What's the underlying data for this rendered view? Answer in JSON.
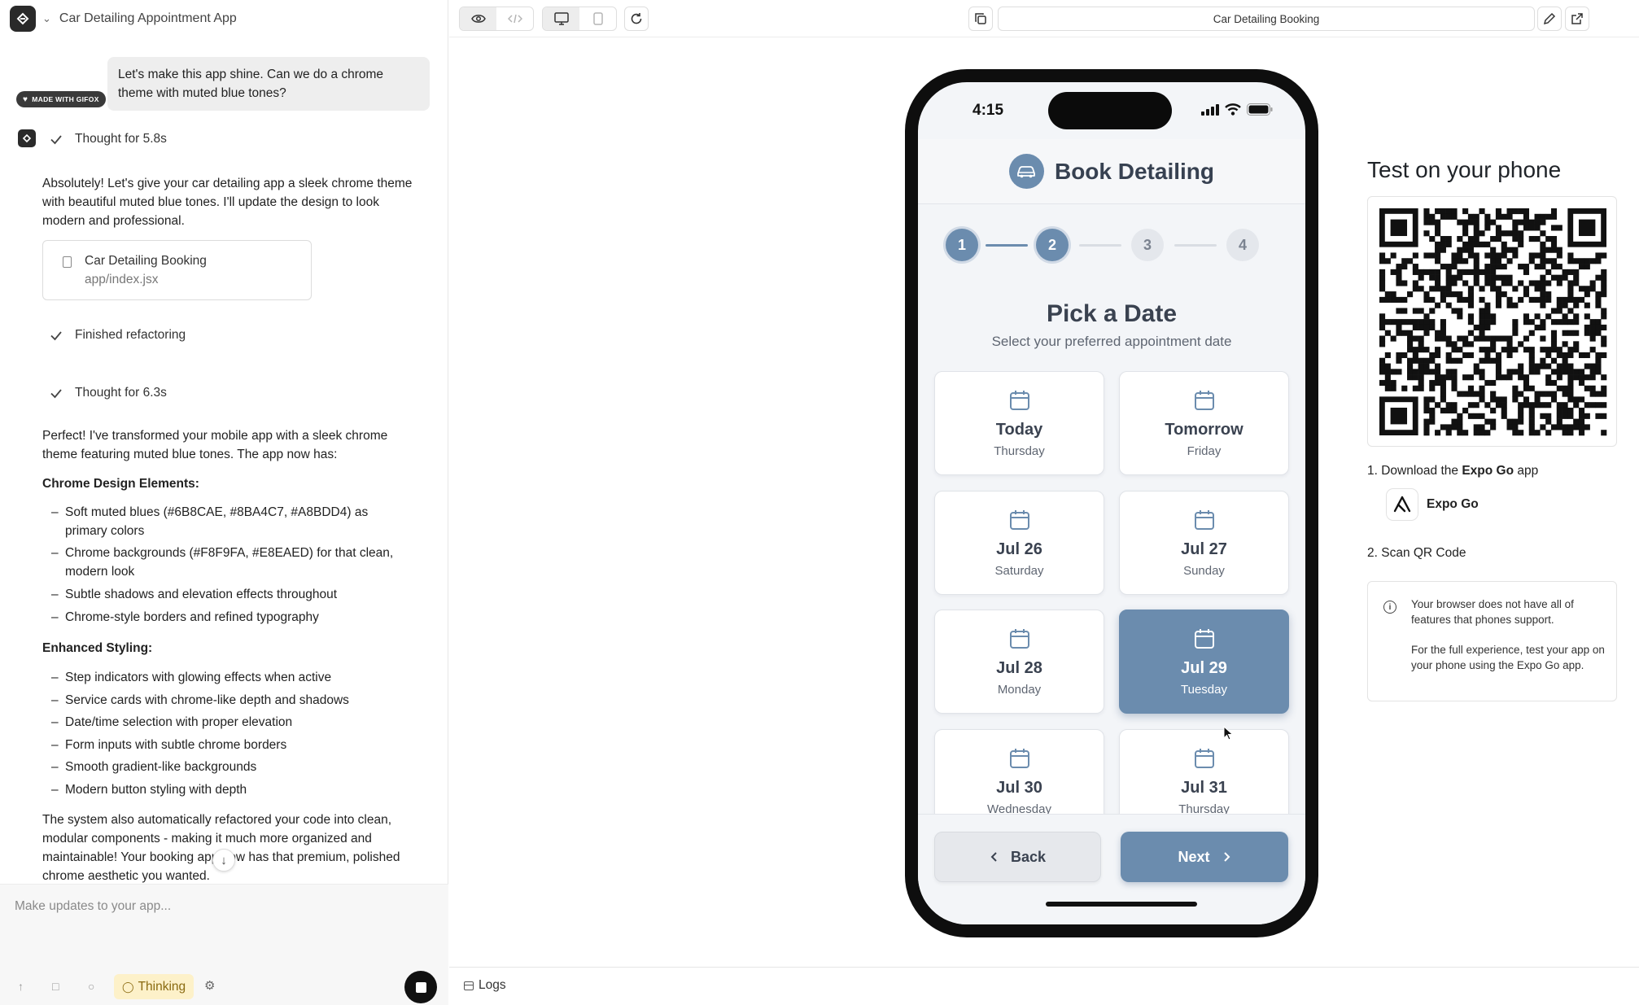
{
  "left": {
    "app_title": "Car Detailing Appointment App",
    "user_message": "Let's make this app shine. Can we do a chrome theme with muted blue tones?",
    "thought_1": "Thought for 5.8s",
    "response_1": "Absolutely! Let's give your car detailing app a sleek chrome theme with beautiful muted blue tones. I'll update the design to look modern and professional.",
    "file_card": {
      "name": "Car Detailing Booking",
      "path": "app/index.jsx"
    },
    "finished": "Finished refactoring",
    "thought_2": "Thought for 6.3s",
    "response_2": "Perfect! I've transformed your mobile app with a sleek chrome theme featuring muted blue tones. The app now has:",
    "section_1_title": "Chrome Design Elements:",
    "section_1_items": [
      "Soft muted blues (#6B8CAE, #8BA4C7, #A8BDD4) as primary colors",
      "Chrome backgrounds (#F8F9FA, #E8EAED) for that clean, modern look",
      "Subtle shadows and elevation effects throughout",
      "Chrome-style borders and refined typography"
    ],
    "section_2_title": "Enhanced Styling:",
    "section_2_items": [
      "Step indicators with glowing effects when active",
      "Service cards with chrome-like depth and shadows",
      "Date/time selection with proper elevation",
      "Form inputs with subtle chrome borders",
      "Smooth gradient-like backgrounds",
      "Modern button styling with depth"
    ],
    "closing": "The system also automatically refactored your code into clean, modular components - making it much more organized and maintainable! Your booking app now has that premium, polished chrome aesthetic you wanted.",
    "composer_placeholder": "Make updates to your app...",
    "gifox_badge": "MADE WITH GIFOX",
    "thinking_label": "Thinking"
  },
  "toolbar": {
    "url_title": "Car Detailing Booking"
  },
  "phone": {
    "time": "4:15",
    "header_title": "Book Detailing",
    "steps": [
      "1",
      "2",
      "3",
      "4"
    ],
    "current_step": 2,
    "heading": "Pick a Date",
    "subheading": "Select your preferred appointment date",
    "dates": [
      {
        "label": "Today",
        "day": "Thursday",
        "selected": false
      },
      {
        "label": "Tomorrow",
        "day": "Friday",
        "selected": false
      },
      {
        "label": "Jul 26",
        "day": "Saturday",
        "selected": false
      },
      {
        "label": "Jul 27",
        "day": "Sunday",
        "selected": false
      },
      {
        "label": "Jul 28",
        "day": "Monday",
        "selected": false
      },
      {
        "label": "Jul 29",
        "day": "Tuesday",
        "selected": true
      },
      {
        "label": "Jul 30",
        "day": "Wednesday",
        "selected": false
      },
      {
        "label": "Jul 31",
        "day": "Thursday",
        "selected": false
      }
    ],
    "back_label": "Back",
    "next_label": "Next",
    "accent_color": "#6B8CAE"
  },
  "qr_panel": {
    "title": "Test on your phone",
    "step_1_prefix": "1. Download the ",
    "step_1_bold": "Expo Go",
    "step_1_suffix": " app",
    "expo_label": "Expo Go",
    "step_2": "2. Scan QR Code",
    "warning_1": "Your browser does not have all of features that phones support.",
    "warning_2": "For the full experience, test your app on your phone using the Expo Go app."
  },
  "logs_label": "Logs"
}
